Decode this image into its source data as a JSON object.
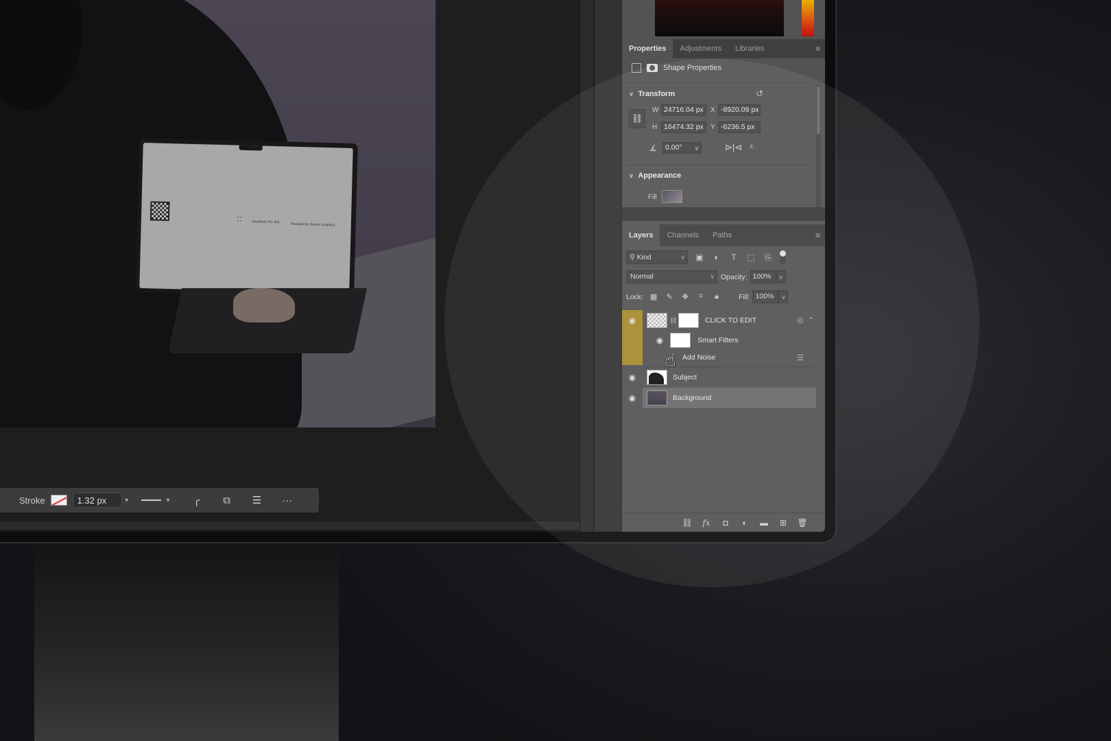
{
  "laptop_screen": {
    "model_text": "MacBook Pro 306",
    "brand_text": "Mockups by Device Graphics"
  },
  "taskbar": {
    "stroke_label": "Stroke",
    "stroke_width": "1.32 px"
  },
  "properties_panel": {
    "tabs": [
      "Properties",
      "Adjustments",
      "Libraries"
    ],
    "active_tab": "Properties",
    "shape_title": "Shape Properties",
    "transform": {
      "heading": "Transform",
      "w_label": "W",
      "w_value": "24716.04 px",
      "h_label": "H",
      "h_value": "16474.32 px",
      "x_label": "X",
      "x_value": "-8920.09 px",
      "y_label": "Y",
      "y_value": "-6236.5 px",
      "angle": "0.00°"
    },
    "appearance": {
      "heading": "Appearance",
      "fill_label": "Fill"
    }
  },
  "layers_panel": {
    "tabs": [
      "Layers",
      "Channels",
      "Paths"
    ],
    "active_tab": "Layers",
    "filter_kind": "Kind",
    "blend_mode": "Normal",
    "opacity_label": "Opacity:",
    "opacity_value": "100%",
    "lock_label": "Lock:",
    "fill_label": "Fill:",
    "fill_value": "100%",
    "layers": [
      {
        "name": "CLICK TO EDIT",
        "selected": true
      },
      {
        "name": "Smart Filters"
      },
      {
        "name": "Add Noise"
      },
      {
        "name": "Subject"
      },
      {
        "name": "Background",
        "highlighted": true
      }
    ]
  },
  "colors": {
    "panel_bg": "#535353",
    "selection_strip": "#a68a2c"
  }
}
